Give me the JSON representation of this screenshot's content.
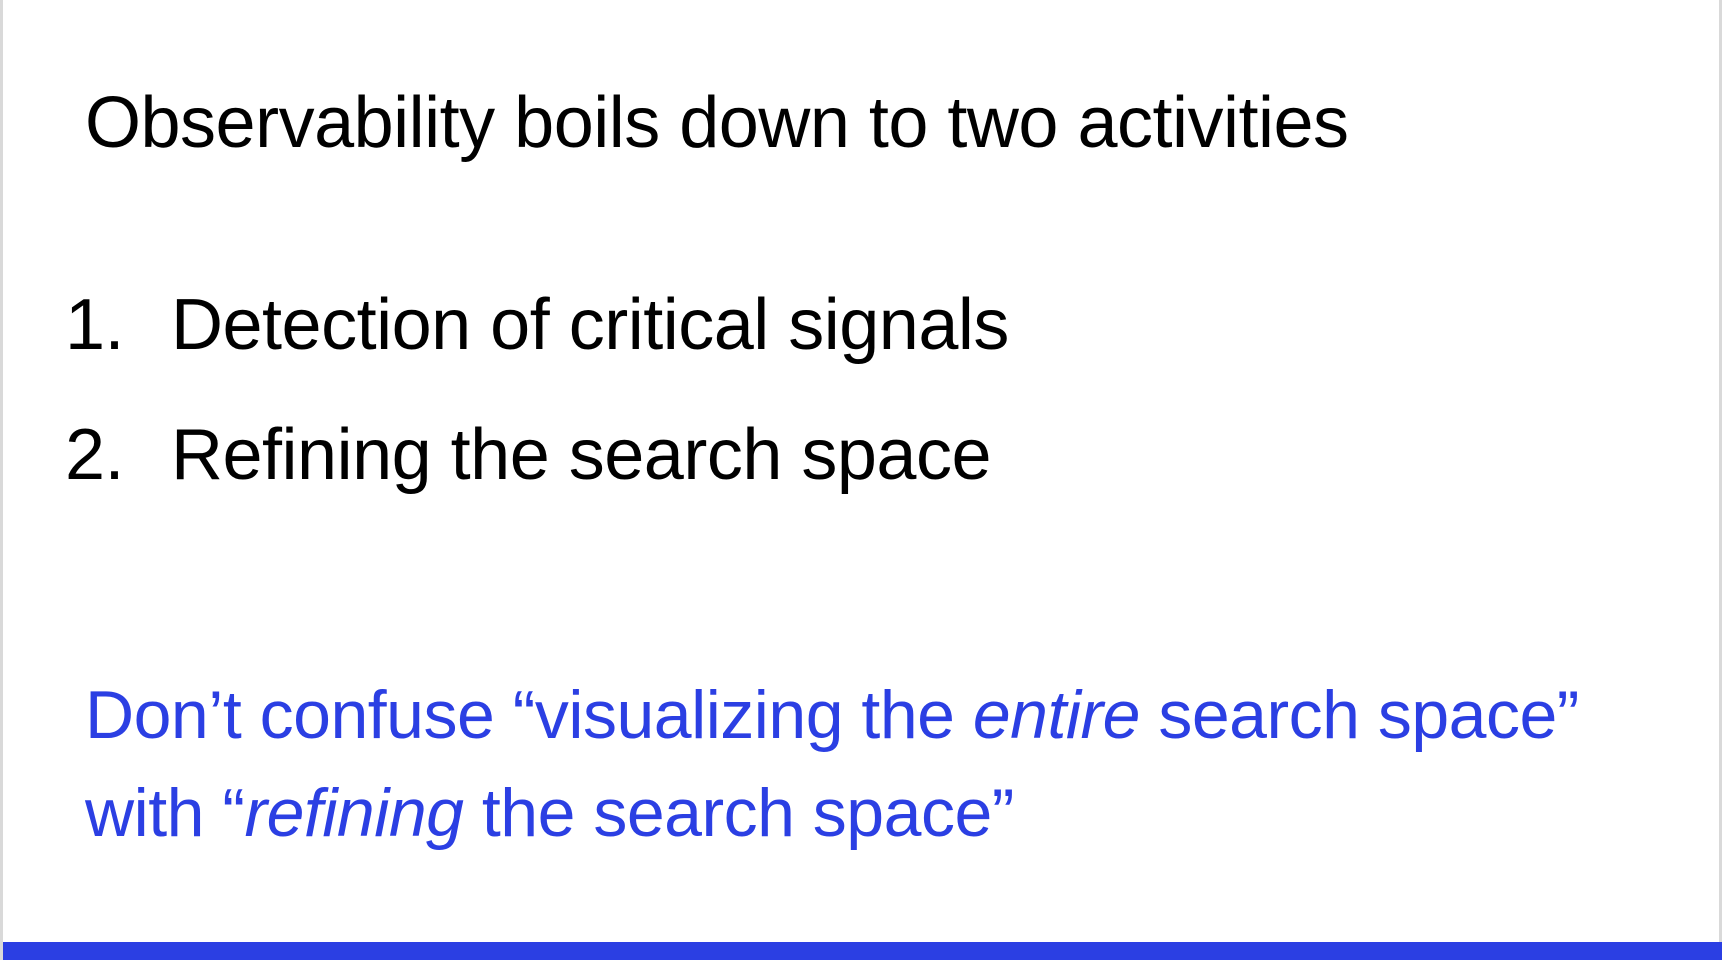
{
  "slide": {
    "title": "Observability boils down to two activities",
    "list": [
      {
        "number": "1.",
        "text": "Detection of critical signals"
      },
      {
        "number": "2.",
        "text": "Refining the search space"
      }
    ],
    "note": {
      "line1_pre": "Don’t confuse “visualizing the ",
      "line1_em": "entire",
      "line1_post": " search space”",
      "line2_pre": "with “",
      "line2_em": "refining",
      "line2_post": " the search space”"
    }
  },
  "colors": {
    "accent": "#2b3fe3",
    "text": "#000000",
    "background": "#ffffff"
  }
}
